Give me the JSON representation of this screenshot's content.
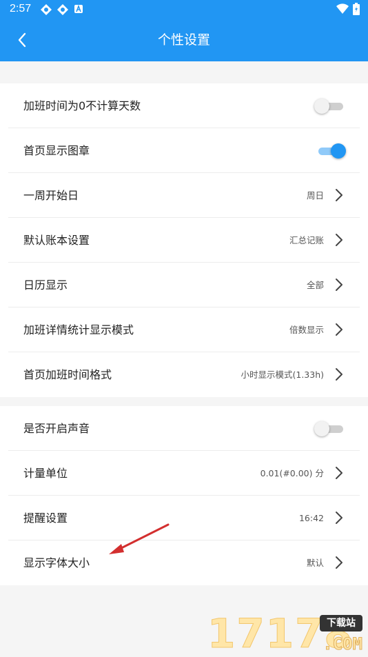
{
  "status": {
    "time": "2:57"
  },
  "appbar": {
    "title": "个性设置"
  },
  "section1": [
    {
      "label": "加班时间为0不计算天数",
      "type": "toggle",
      "on": false
    },
    {
      "label": "首页显示图章",
      "type": "toggle",
      "on": true
    },
    {
      "label": "一周开始日",
      "type": "value",
      "value": "周日"
    },
    {
      "label": "默认账本设置",
      "type": "value",
      "value": "汇总记账"
    },
    {
      "label": "日历显示",
      "type": "value",
      "value": "全部"
    },
    {
      "label": "加班详情统计显示模式",
      "type": "value",
      "value": "倍数显示"
    },
    {
      "label": "首页加班时间格式",
      "type": "value",
      "value": "小时显示模式(1.33h)"
    }
  ],
  "section2": [
    {
      "label": "是否开启声音",
      "type": "toggle",
      "on": false
    },
    {
      "label": "计量单位",
      "type": "value",
      "value": "0.01(#0.00) 分"
    },
    {
      "label": "提醒设置",
      "type": "value",
      "value": "16:42"
    },
    {
      "label": "显示字体大小",
      "type": "value",
      "value": "默认"
    }
  ],
  "watermark": {
    "number": "17178",
    "badge": "下载站",
    "suffix": ".COM"
  },
  "colors": {
    "primary": "#2196f3",
    "toggle_track_on": "#90caf9",
    "arrow": "#d32f2f"
  }
}
